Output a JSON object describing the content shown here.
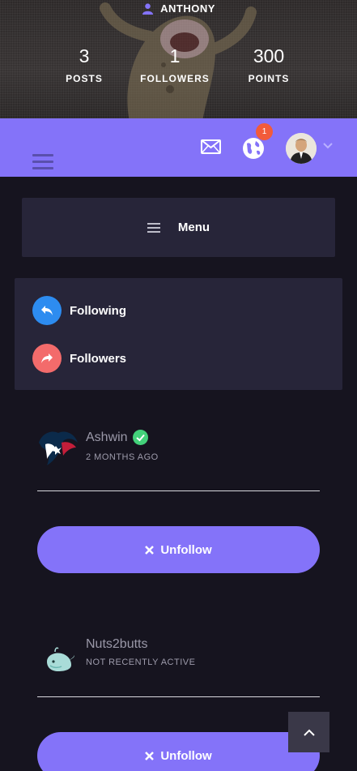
{
  "profile": {
    "name": "ANTHONY",
    "stats": [
      {
        "value": "3",
        "label": "POSTS"
      },
      {
        "value": "1",
        "label": "FOLLOWERS"
      },
      {
        "value": "300",
        "label": "POINTS"
      }
    ]
  },
  "topbar": {
    "notification_count": "1"
  },
  "menu": {
    "label": "Menu"
  },
  "nav": {
    "following_label": "Following",
    "followers_label": "Followers"
  },
  "users": [
    {
      "name": "Ashwin",
      "status": "2 MONTHS AGO",
      "verified": true,
      "button_label": "Unfollow"
    },
    {
      "name": "Nuts2butts",
      "status": "NOT RECENTLY ACTIVE",
      "verified": false,
      "button_label": "Unfollow"
    }
  ],
  "colors": {
    "accent": "#8473f9",
    "background": "#16141f",
    "panel": "#272539",
    "following_icon": "#2d8cf0",
    "followers_icon": "#f36b6b",
    "verified": "#43d17a",
    "badge": "#f25b3a"
  }
}
